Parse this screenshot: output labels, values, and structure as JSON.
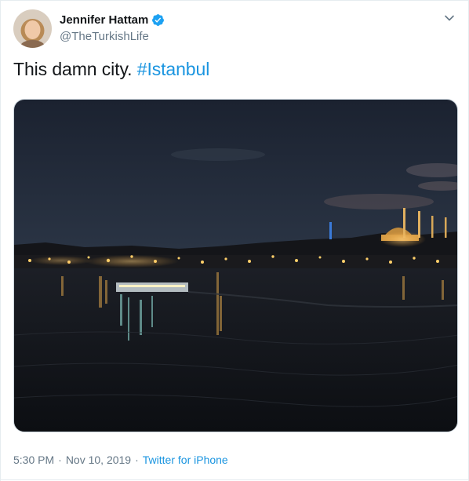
{
  "tweet": {
    "author": {
      "display_name": "Jennifer Hattam",
      "handle": "@TheTurkishLife",
      "verified": true
    },
    "text": "This damn city. ",
    "hashtag": "#Istanbul",
    "time": "5:30 PM",
    "separator": "·",
    "date": "Nov 10, 2019",
    "source": "Twitter for iPhone"
  },
  "colors": {
    "link": "#1b95e0",
    "text": "#14171a",
    "muted": "#657786",
    "border": "#e6ecf0"
  },
  "icons": {
    "verified": "verified-badge-icon",
    "menu": "chevron-down-icon"
  }
}
